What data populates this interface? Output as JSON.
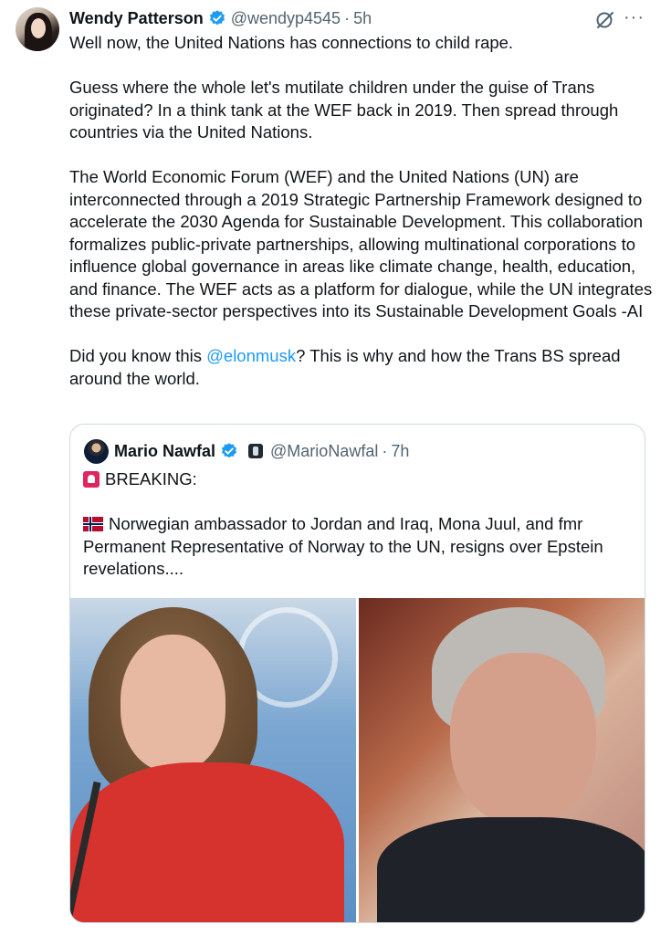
{
  "post": {
    "author_name": "Wendy Patterson",
    "handle": "@wendyp4545",
    "separator": "·",
    "time": "5h",
    "paragraphs": [
      "Well now, the United Nations has connections to child rape.",
      "Guess where the whole let's mutilate children under the guise of Trans originated?  In a think tank at the WEF back in 2019. Then spread through countries via the United Nations.",
      "The World Economic Forum (WEF) and the United Nations (UN) are interconnected through a 2019 Strategic Partnership Framework designed to accelerate the 2030 Agenda for Sustainable Development. This collaboration formalizes public-private partnerships, allowing multinational corporations to influence global governance in areas like climate change, health, education, and finance. The WEF acts as a platform for dialogue, while the UN integrates these private-sector perspectives into its Sustainable Development Goals -AI"
    ],
    "last_paragraph": {
      "before": "Did you know this ",
      "mention": "@elonmusk",
      "after": "?  This is why and how the Trans BS spread around the world."
    }
  },
  "quoted": {
    "author_name": "Mario Nawfal",
    "handle": "@MarioNawfal",
    "separator": "·",
    "time": "7h",
    "line1": "BREAKING:",
    "line2": "Norwegian ambassador to Jordan and Iraq, Mona Juul, and fmr Permanent Representative of Norway to the UN, resigns over Epstein revelations...."
  },
  "icons": {
    "verified": "verified-badge-icon",
    "grok": "grok-icon",
    "more": "more-icon",
    "siren": "siren-emoji-icon",
    "flag": "norway-flag-icon"
  },
  "colors": {
    "text": "#0f1419",
    "secondary": "#536471",
    "accent": "#1d9bf0",
    "border": "#cfd9de"
  }
}
